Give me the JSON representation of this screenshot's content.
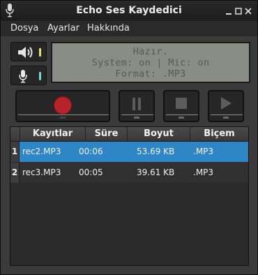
{
  "window": {
    "title": "Echo Ses Kaydedici"
  },
  "menu": [
    {
      "label": "Dosya"
    },
    {
      "label": "Ayarlar"
    },
    {
      "label": "Hakkında"
    }
  ],
  "audio_sources": {
    "speaker": {
      "icon": "speaker-icon",
      "led_color": "#e8e070"
    },
    "microphone": {
      "icon": "microphone-icon",
      "led_color": "#6fe0c8"
    }
  },
  "lcd": {
    "line1": "Hazır.",
    "line2": "System: on | Mic: on",
    "line3": "Format: .MP3"
  },
  "transport": {
    "record": {
      "icon": "record-icon",
      "accent": "#c0282a"
    },
    "pause": {
      "icon": "pause-icon"
    },
    "stop": {
      "icon": "stop-icon"
    },
    "play": {
      "icon": "play-icon"
    }
  },
  "table": {
    "headers": [
      "Kayıtlar",
      "Süre",
      "Boyut",
      "Biçem"
    ],
    "rows": [
      {
        "num": "1",
        "name": "rec2.MP3",
        "duration": "00:06",
        "size": "53.69 KB",
        "format": ".MP3",
        "selected": true
      },
      {
        "num": "2",
        "name": "rec3.MP3",
        "duration": "00:05",
        "size": "39.61 KB",
        "format": ".MP3",
        "selected": false
      }
    ]
  },
  "colors": {
    "selection": "#2e86c5",
    "lcd_background": "#8a8c86",
    "lcd_text": "#555b55"
  }
}
